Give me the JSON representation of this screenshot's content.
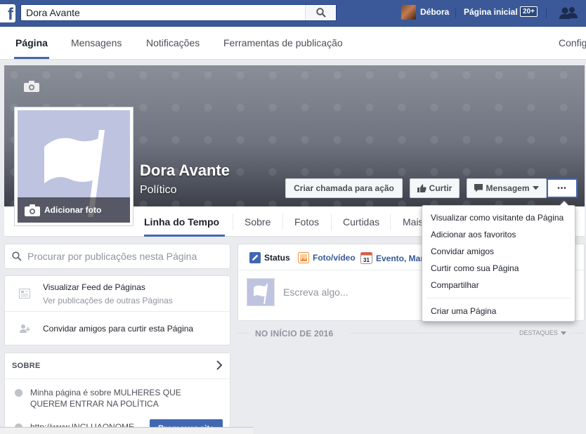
{
  "topbar": {
    "logo": "f",
    "search_value": "Dora Avante",
    "user_name": "Débora",
    "home_label": "Página inicial",
    "home_badge": "20+"
  },
  "admin_tabs": [
    {
      "label": "Página",
      "active": true
    },
    {
      "label": "Mensagens"
    },
    {
      "label": "Notificações"
    },
    {
      "label": "Ferramentas de publicação"
    },
    {
      "label": "Config"
    }
  ],
  "page": {
    "name": "Dora Avante",
    "category": "Político",
    "add_photo": "Adicionar foto"
  },
  "cover_buttons": {
    "cta": "Criar chamada para ação",
    "like": "Curtir",
    "message": "Mensagem",
    "more": "•••"
  },
  "page_tabs": [
    {
      "label": "Linha do Tempo",
      "active": true
    },
    {
      "label": "Sobre"
    },
    {
      "label": "Fotos"
    },
    {
      "label": "Curtidas"
    },
    {
      "label": "Mais"
    }
  ],
  "sidebar": {
    "search_placeholder": "Procurar por publicações nesta Página",
    "feed_title": "Visualizar Feed de Páginas",
    "feed_sub": "Ver publicações de outras Páginas",
    "invite": "Convidar amigos para curtir esta Página",
    "about_header": "SOBRE",
    "about_text": "Minha página é sobre MULHERES QUE QUEREM ENTRAR NA POLÍTICA",
    "about_url": "http://www.INCLUAONOME",
    "promote": "Promover site"
  },
  "composer": {
    "tabs": [
      "Status",
      "Foto/vídeo",
      "Evento, Mar"
    ],
    "calendar_day": "31",
    "placeholder": "Escreva algo..."
  },
  "timeline": {
    "label": "NO INÍCIO DE 2016",
    "highlights": "DESTAQUES"
  },
  "dropdown": {
    "items": [
      "Visualizar como visitante da Página",
      "Adicionar aos favoritos",
      "Convidar amigos",
      "Curtir como sua Página",
      "Compartilhar"
    ],
    "footer_item": "Criar uma Página"
  },
  "colors": {
    "brand": "#3b5998",
    "accent": "#4267b2"
  }
}
